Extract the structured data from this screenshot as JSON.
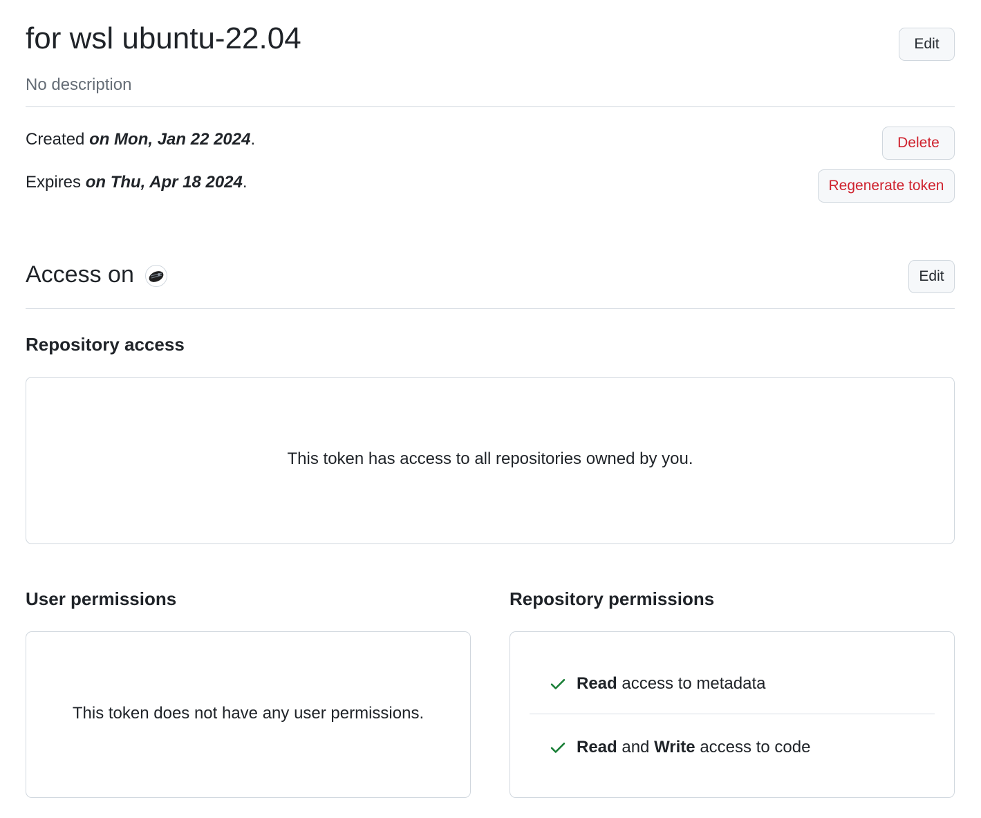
{
  "token": {
    "name": "for wsl ubuntu-22.04",
    "description": "No description",
    "edit_label": "Edit"
  },
  "dates": {
    "created_prefix": "Created ",
    "created_value": "on Mon, Jan 22 2024",
    "expires_prefix": "Expires ",
    "expires_value": "on Thu, Apr 18 2024",
    "period": "."
  },
  "actions": {
    "delete_label": "Delete",
    "regenerate_label": "Regenerate token"
  },
  "access": {
    "heading": "Access on",
    "edit_label": "Edit",
    "avatar_icon": "owner-avatar-icon"
  },
  "repository_access": {
    "heading": "Repository access",
    "message": "This token has access to all repositories owned by you."
  },
  "user_permissions": {
    "heading": "User permissions",
    "message": "This token does not have any user permissions."
  },
  "repository_permissions": {
    "heading": "Repository permissions",
    "items": [
      {
        "icon": "check-icon",
        "level_1": "Read",
        "joiner": "",
        "level_2": "",
        "rest": " access to metadata"
      },
      {
        "icon": "check-icon",
        "level_1": "Read",
        "joiner": " and ",
        "level_2": "Write",
        "rest": " access to code"
      }
    ]
  },
  "colors": {
    "danger": "#cf222e",
    "success": "#1a7f37",
    "muted": "#656d76",
    "border": "#d0d7de"
  }
}
